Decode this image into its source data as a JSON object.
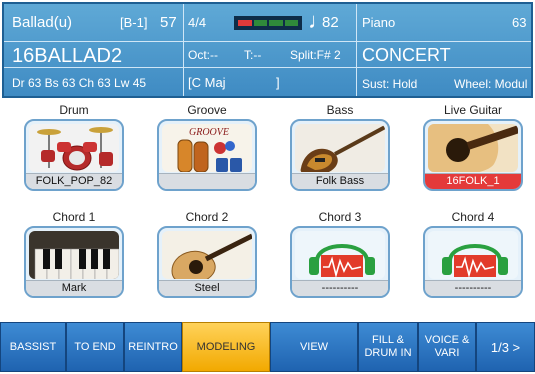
{
  "header": {
    "style_name": "Ballad(u)",
    "bank": "[B-1]",
    "style_number": "57",
    "time_sig": "4/4",
    "tempo": "82",
    "style_big": "16BALLAD2",
    "oct": "Oct:--",
    "transpose": "T:--",
    "split": "Split:F# 2",
    "volumes": "Dr 63  Bs 63  Ch 63  Lw 45",
    "chord": "[C Maj",
    "chord_close": "]",
    "voice_bank": "Piano",
    "voice_number": "63",
    "voice_name": "CONCERT",
    "sustain": "Sust: Hold",
    "wheel": "Wheel: Modul",
    "tempo_colors": [
      "#e03a3a",
      "#2f8a3a",
      "#2f8a3a",
      "#2f8a3a"
    ]
  },
  "pads": [
    {
      "title": "Drum",
      "label": "FOLK_POP_82",
      "icon": "drum-kit-icon"
    },
    {
      "title": "Groove",
      "label": "",
      "icon": "groove-percussion-icon",
      "art_text": "GROOVE"
    },
    {
      "title": "Bass",
      "label": "Folk Bass",
      "icon": "bass-guitar-icon"
    },
    {
      "title": "Live Guitar",
      "label": "16FOLK_1",
      "icon": "acoustic-guitar-icon",
      "highlight": true
    },
    {
      "title": "Chord 1",
      "label": "Mark",
      "icon": "piano-keys-icon"
    },
    {
      "title": "Chord 2",
      "label": "Steel",
      "icon": "acoustic-guitar-icon"
    },
    {
      "title": "Chord 3",
      "label": "----------",
      "icon": "headphones-wave-icon"
    },
    {
      "title": "Chord 4",
      "label": "----------",
      "icon": "headphones-wave-icon"
    }
  ],
  "buttons": [
    {
      "label": "BASSIST"
    },
    {
      "label": "TO END"
    },
    {
      "label": "REINTRO"
    },
    {
      "label": "MODELING",
      "selected": true
    },
    {
      "label": "VIEW"
    },
    {
      "label": "FILL &",
      "label2": "DRUM IN"
    },
    {
      "label": "VOICE &",
      "label2": "VARI"
    },
    {
      "label": "1/3 >"
    }
  ]
}
